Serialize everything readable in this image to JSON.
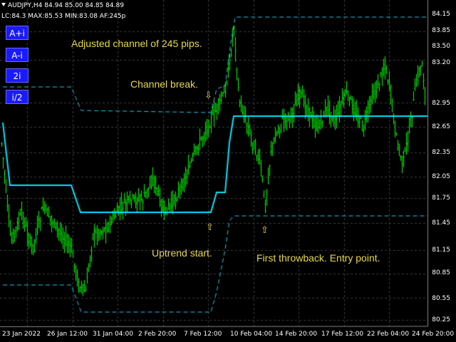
{
  "header": {
    "symbol_line": "AUDJPY,H4  84.94 85.00 84.85 84.89",
    "info_line": "LC:84.3 MAX:85.53 MIN:83.08 AF:245p"
  },
  "buttons": [
    "A+i",
    "A-i",
    "2i",
    "i/2"
  ],
  "annotations": {
    "channel": "Adjusted channel of 245 pips.",
    "break": "Channel break.",
    "uptrend": "Uptrend start.",
    "throwback": "First throwback. Entry point."
  },
  "arrows": {
    "break": "⇩",
    "uptrend": "⇧",
    "throwback": "⇧"
  },
  "y_axis": [
    "84.15",
    "83.85",
    "83.50",
    "83.20",
    "82.95",
    "82.65",
    "82.35",
    "82.05",
    "81.75",
    "81.45",
    "81.15",
    "80.85",
    "80.55",
    "80.25"
  ],
  "x_axis": [
    "23 Jan 2022",
    "26 Jan 12:00",
    "31 Jan 04:00",
    "2 Feb 20:00",
    "7 Feb 12:00",
    "10 Feb 04:00",
    "14 Feb 20:00",
    "17 Feb 12:00",
    "22 Feb 04:00",
    "24 Feb 20:00"
  ],
  "colors": {
    "background": "#000000",
    "bars": "#00ff00",
    "channel_mid": "#00e5ff",
    "channel_band": "#22c8e8",
    "grid": "#3c3c3c",
    "annotation": "#e8d84a",
    "button": "#1a1aff"
  }
}
